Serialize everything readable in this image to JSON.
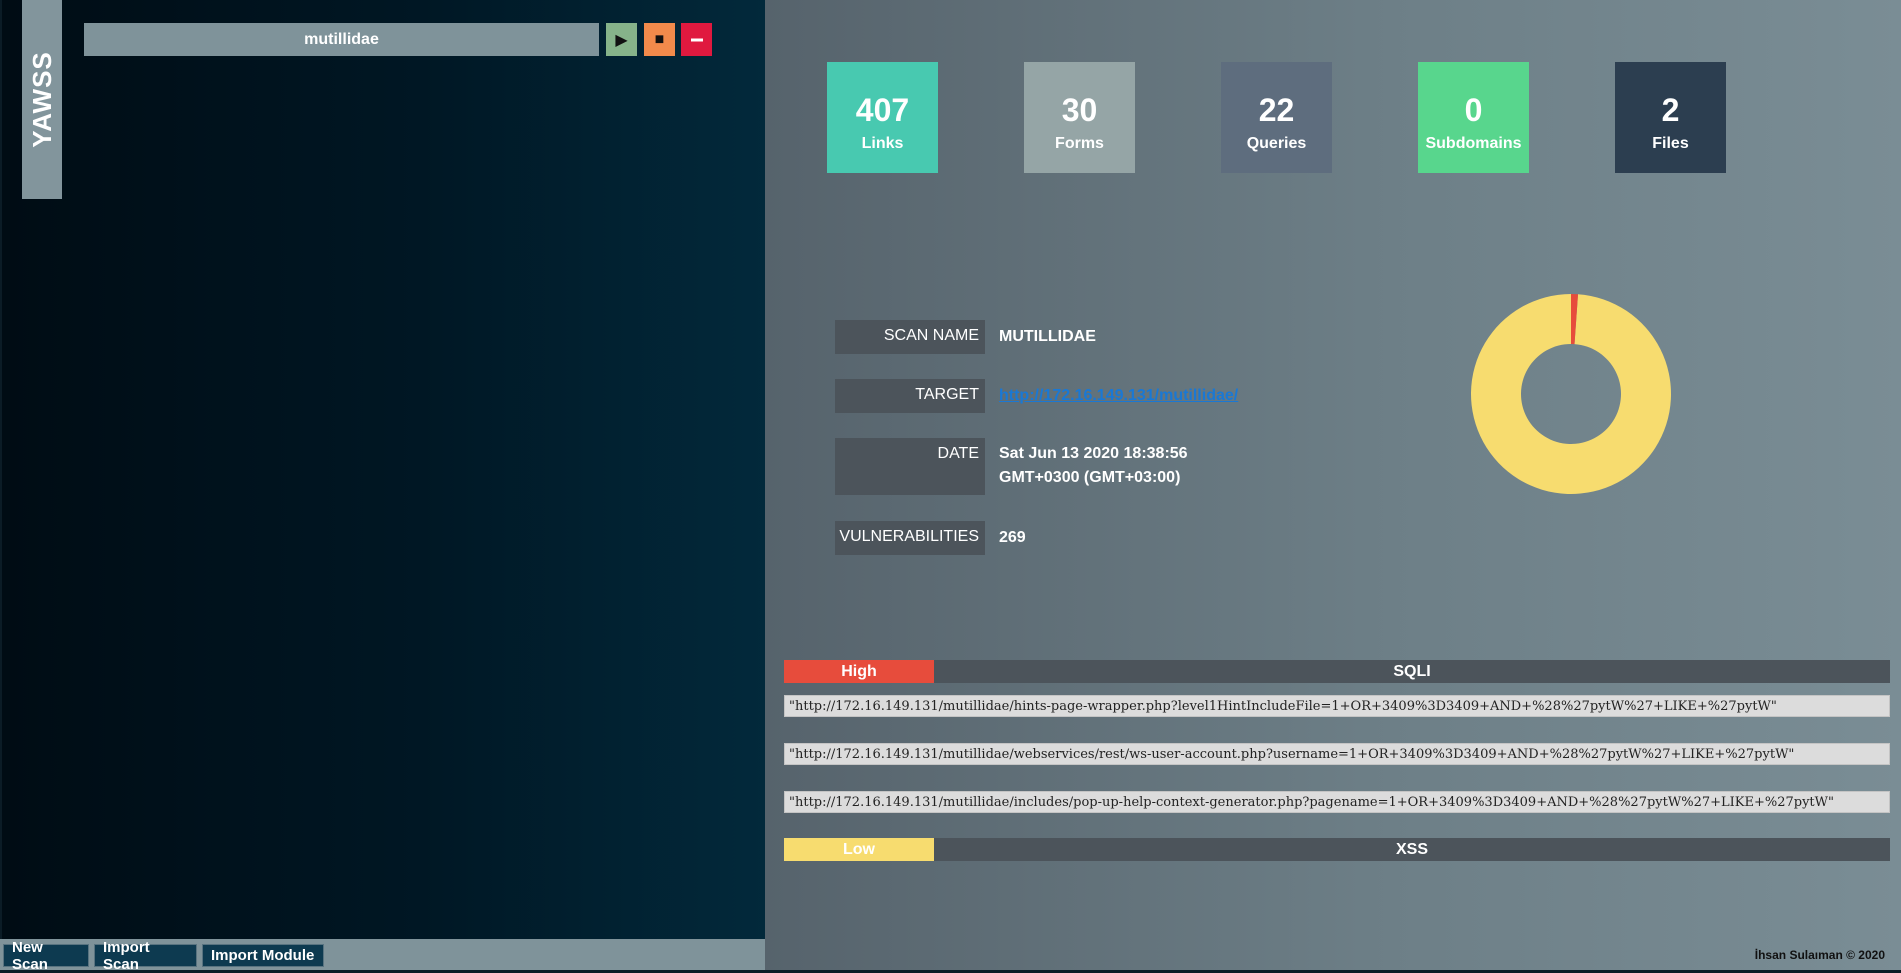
{
  "sidebar": {
    "brand": "YAWSS",
    "scans": [
      {
        "name": "mutillidae"
      }
    ],
    "controls": {
      "play_icon": "play-icon",
      "stop_icon": "stop-icon",
      "remove_icon": "minus-icon"
    }
  },
  "bottom_bar": {
    "new_scan": "New Scan",
    "import_scan": "Import Scan",
    "import_module": "Import Module"
  },
  "stats": [
    {
      "value": "407",
      "label": "Links",
      "color": "#48c9b0"
    },
    {
      "value": "30",
      "label": "Forms",
      "color": "#95a5a6"
    },
    {
      "value": "22",
      "label": "Queries",
      "color": "#5e6d7e"
    },
    {
      "value": "0",
      "label": "Subdomains",
      "color": "#58d68d"
    },
    {
      "value": "2",
      "label": "Files",
      "color": "#2c3e50"
    }
  ],
  "scan_info": {
    "scan_name_label": "SCAN NAME",
    "scan_name": "MUTILLIDAE",
    "target_label": "TARGET",
    "target": "http://172.16.149.131/mutillidae/",
    "date_label": "DATE",
    "date": "Sat Jun 13 2020 18:38:56 GMT+0300 (GMT+03:00)",
    "vulnerabilities_label": "VULNERABILITIES",
    "vulnerabilities": "269"
  },
  "chart_data": {
    "type": "pie",
    "donut": true,
    "title": "",
    "slices": [
      {
        "value": 266,
        "color": "#f7dc6f"
      },
      {
        "value": 3,
        "color": "#e74c3c"
      }
    ]
  },
  "findings": [
    {
      "severity": "High",
      "severity_color": "#e74c3c",
      "type": "SQLI",
      "urls": [
        "\"http://172.16.149.131/mutillidae/hints-page-wrapper.php?level1HintIncludeFile=1+OR+3409%3D3409+AND+%28%27pytW%27+LIKE+%27pytW\"",
        "\"http://172.16.149.131/mutillidae/webservices/rest/ws-user-account.php?username=1+OR+3409%3D3409+AND+%28%27pytW%27+LIKE+%27pytW\"",
        "\"http://172.16.149.131/mutillidae/includes/pop-up-help-context-generator.php?pagename=1+OR+3409%3D3409+AND+%28%27pytW%27+LIKE+%27pytW\""
      ]
    },
    {
      "severity": "Low",
      "severity_color": "#f7dc6f",
      "type": "XSS",
      "urls": []
    }
  ],
  "footer": {
    "credit": "İhsan Sulaıman © 2020"
  }
}
